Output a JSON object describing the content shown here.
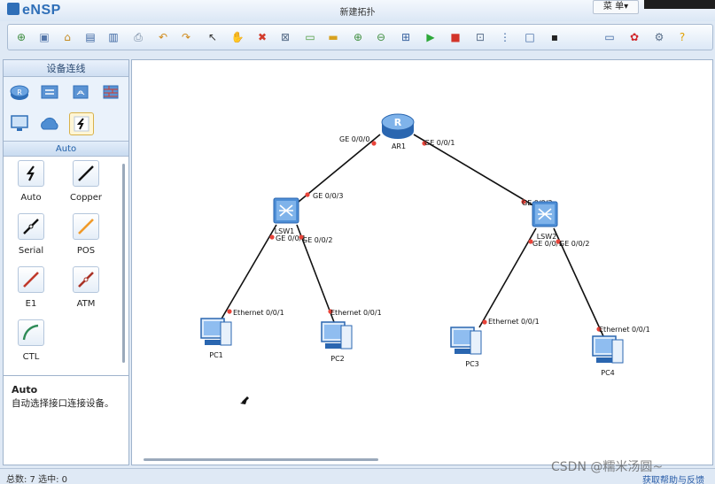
{
  "app": {
    "name": "eNSP",
    "window_title": "新建拓扑",
    "menu_label": "菜 单▾"
  },
  "toolbar": {
    "buttons": [
      {
        "name": "new-topology",
        "glyph": "⊕",
        "color": "#3d8c3d"
      },
      {
        "name": "new-example",
        "glyph": "▣",
        "color": "#5577aa"
      },
      {
        "name": "open",
        "glyph": "⌂",
        "color": "#c58a1e"
      },
      {
        "name": "save",
        "glyph": "▤",
        "color": "#3a64a0"
      },
      {
        "name": "save-as",
        "glyph": "▥",
        "color": "#3a64a0"
      },
      {
        "name": "print",
        "glyph": "⎙",
        "color": "#6a7f99"
      },
      {
        "name": "undo",
        "glyph": "↶",
        "color": "#d08a1a"
      },
      {
        "name": "redo",
        "glyph": "↷",
        "color": "#d08a1a"
      },
      {
        "name": "select",
        "glyph": "↖",
        "color": "#333333"
      },
      {
        "name": "drag",
        "glyph": "✋",
        "color": "#c8902a"
      },
      {
        "name": "delete",
        "glyph": "✖",
        "color": "#d23b2b"
      },
      {
        "name": "delete-all",
        "glyph": "⊠",
        "color": "#5a6f8a"
      },
      {
        "name": "text-note",
        "glyph": "▭",
        "color": "#4b9a3c"
      },
      {
        "name": "rectangle",
        "glyph": "▬",
        "color": "#d7a220"
      },
      {
        "name": "zoom-in",
        "glyph": "⊕",
        "color": "#3f8e3f"
      },
      {
        "name": "zoom-out",
        "glyph": "⊖",
        "color": "#3f8e3f"
      },
      {
        "name": "fit-view",
        "glyph": "⊞",
        "color": "#3a64a0"
      },
      {
        "name": "start-devices",
        "glyph": "▶",
        "color": "#2da83a"
      },
      {
        "name": "stop-devices",
        "glyph": "■",
        "color": "#d2342a"
      },
      {
        "name": "capture",
        "glyph": "⊡",
        "color": "#5a6f8a"
      },
      {
        "name": "topology-tree",
        "glyph": "⋮",
        "color": "#3a64a0"
      },
      {
        "name": "show-labels",
        "glyph": "□",
        "color": "#3a64a0"
      },
      {
        "name": "screenshot",
        "glyph": "▪",
        "color": "#222222"
      },
      {
        "name": "messages",
        "glyph": "▭",
        "color": "#3a64a0"
      },
      {
        "name": "huawei",
        "glyph": "✿",
        "color": "#d0262a"
      },
      {
        "name": "settings",
        "glyph": "⚙",
        "color": "#5a6f8a"
      },
      {
        "name": "help",
        "glyph": "?",
        "color": "#e0a000"
      }
    ]
  },
  "left_panel": {
    "title": "设备连线",
    "categories": [
      {
        "name": "router",
        "icon": "router-icon"
      },
      {
        "name": "switch",
        "icon": "switch-icon"
      },
      {
        "name": "wlan",
        "icon": "wlan-icon"
      },
      {
        "name": "firewall",
        "icon": "firewall-icon"
      },
      {
        "name": "pc",
        "icon": "pc-icon"
      },
      {
        "name": "cloud",
        "icon": "cloud-icon"
      },
      {
        "name": "cable",
        "icon": "cable-icon"
      }
    ],
    "subheader": "Auto",
    "cables": [
      {
        "label": "Auto",
        "color": "#111111"
      },
      {
        "label": "Copper",
        "color": "#111111"
      },
      {
        "label": "Serial",
        "color": "#111111"
      },
      {
        "label": "POS",
        "color": "#f09a2a"
      },
      {
        "label": "E1",
        "color": "#c0392b"
      },
      {
        "label": "ATM",
        "color": "#a93226"
      },
      {
        "label": "CTL",
        "color": "#2e8b57"
      }
    ],
    "description": {
      "title": "Auto",
      "text": "自动选择接口连接设备。"
    }
  },
  "topology": {
    "devices": [
      {
        "id": "AR1",
        "type": "router",
        "label": "AR1"
      },
      {
        "id": "LSW1",
        "type": "switch",
        "label": "LSW1"
      },
      {
        "id": "LSW2",
        "type": "switch",
        "label": "LSW2"
      },
      {
        "id": "PC1",
        "type": "pc",
        "label": "PC1"
      },
      {
        "id": "PC2",
        "type": "pc",
        "label": "PC2"
      },
      {
        "id": "PC3",
        "type": "pc",
        "label": "PC3"
      },
      {
        "id": "PC4",
        "type": "pc",
        "label": "PC4"
      }
    ],
    "links": [
      {
        "from": "AR1",
        "to": "LSW1",
        "from_port": "GE 0/0/0",
        "to_port": "GE 0/0/3"
      },
      {
        "from": "AR1",
        "to": "LSW2",
        "from_port": "GE 0/0/1",
        "to_port": "GE 0/0/3"
      },
      {
        "from": "LSW1",
        "to": "PC1",
        "from_port": "GE 0/0/1",
        "to_port": "Ethernet 0/0/1"
      },
      {
        "from": "LSW1",
        "to": "PC2",
        "from_port": "GE 0/0/2",
        "to_port": "Ethernet 0/0/1"
      },
      {
        "from": "LSW2",
        "to": "PC3",
        "from_port": "GE 0/0/1",
        "to_port": "Ethernet 0/0/1"
      },
      {
        "from": "LSW2",
        "to": "PC4",
        "from_port": "GE 0/0/2",
        "to_port": "Ethernet 0/0/1"
      }
    ],
    "port_dot_color": "#e8443a"
  },
  "status": {
    "left": "总数: 7 选中: 0",
    "right": "获取帮助与反馈"
  },
  "watermark": "CSDN @糯米汤圆~"
}
